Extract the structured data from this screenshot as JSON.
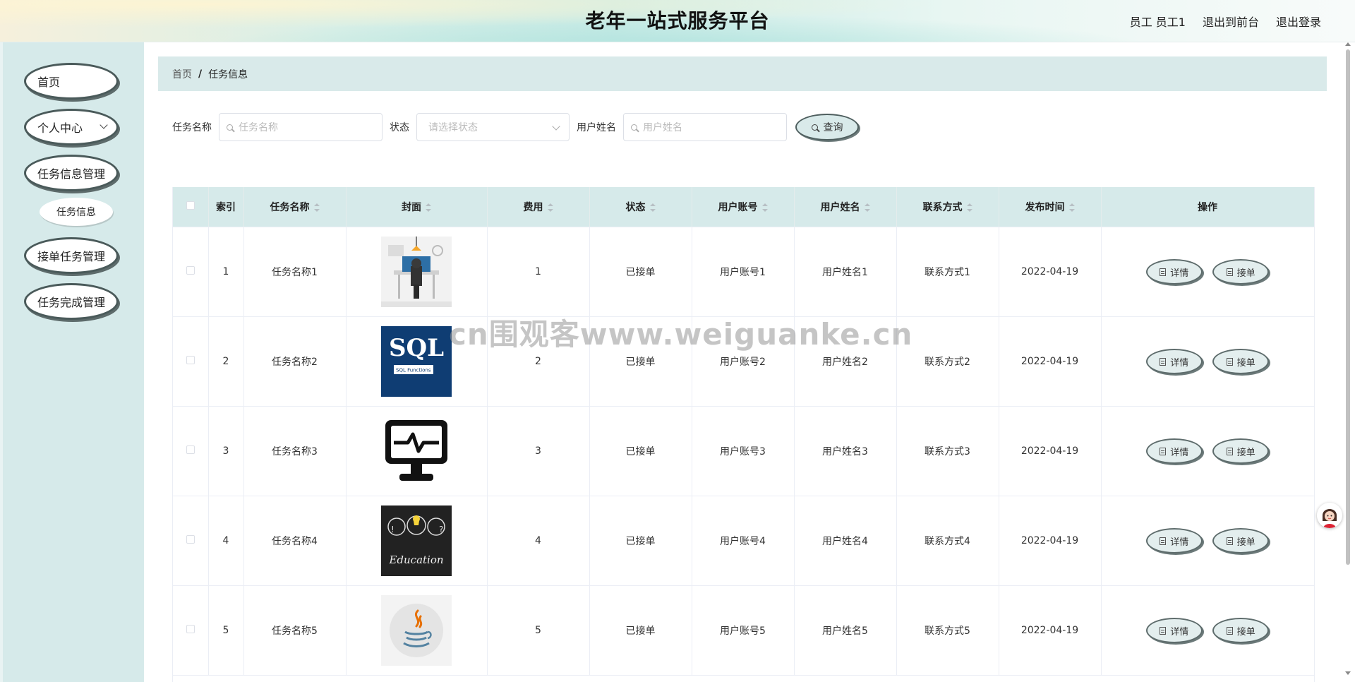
{
  "header": {
    "title": "老年一站式服务平台",
    "user_label": "员工 员工1",
    "back_front": "退出到前台",
    "logout": "退出登录"
  },
  "sidebar": {
    "items": [
      {
        "label": "首页"
      },
      {
        "label": "个人中心"
      },
      {
        "label": "任务信息管理"
      },
      {
        "label": "任务信息"
      },
      {
        "label": "接单任务管理"
      },
      {
        "label": "任务完成管理"
      }
    ]
  },
  "breadcrumb": {
    "home": "首页",
    "separator": "/",
    "current": "任务信息"
  },
  "filters": {
    "task_name_label": "任务名称",
    "task_name_placeholder": "任务名称",
    "status_label": "状态",
    "status_placeholder": "请选择状态",
    "user_name_label": "用户姓名",
    "user_name_placeholder": "用户姓名",
    "query_button": "查询"
  },
  "table": {
    "headers": [
      "索引",
      "任务名称",
      "封面",
      "费用",
      "状态",
      "用户账号",
      "用户姓名",
      "联系方式",
      "发布时间",
      "操作"
    ],
    "rows": [
      {
        "index": "1",
        "name": "任务名称1",
        "cover": "office-illustration",
        "fee": "1",
        "status": "已接单",
        "account": "用户账号1",
        "username": "用户姓名1",
        "contact": "联系方式1",
        "time": "2022-04-19"
      },
      {
        "index": "2",
        "name": "任务名称2",
        "cover": "sql-book",
        "fee": "2",
        "status": "已接单",
        "account": "用户账号2",
        "username": "用户姓名2",
        "contact": "联系方式2",
        "time": "2022-04-19"
      },
      {
        "index": "3",
        "name": "任务名称3",
        "cover": "monitor-icon",
        "fee": "3",
        "status": "已接单",
        "account": "用户账号3",
        "username": "用户姓名3",
        "contact": "联系方式3",
        "time": "2022-04-19"
      },
      {
        "index": "4",
        "name": "任务名称4",
        "cover": "education-chalkboard",
        "fee": "4",
        "status": "已接单",
        "account": "用户账号4",
        "username": "用户姓名4",
        "contact": "联系方式4",
        "time": "2022-04-19"
      },
      {
        "index": "5",
        "name": "任务名称5",
        "cover": "java-logo",
        "fee": "5",
        "status": "已接单",
        "account": "用户账号5",
        "username": "用户姓名5",
        "contact": "联系方式5",
        "time": "2022-04-19"
      }
    ],
    "detail_button": "详情",
    "accept_button": "接单",
    "sql_cover_text": "SQL",
    "sql_cover_sub": "SQL Functions",
    "education_cover_text": "Education"
  },
  "watermark": "cn围观客www.weiguanke.cn",
  "colors": {
    "accent": "#d6eaea",
    "border": "#4a5a5a"
  }
}
